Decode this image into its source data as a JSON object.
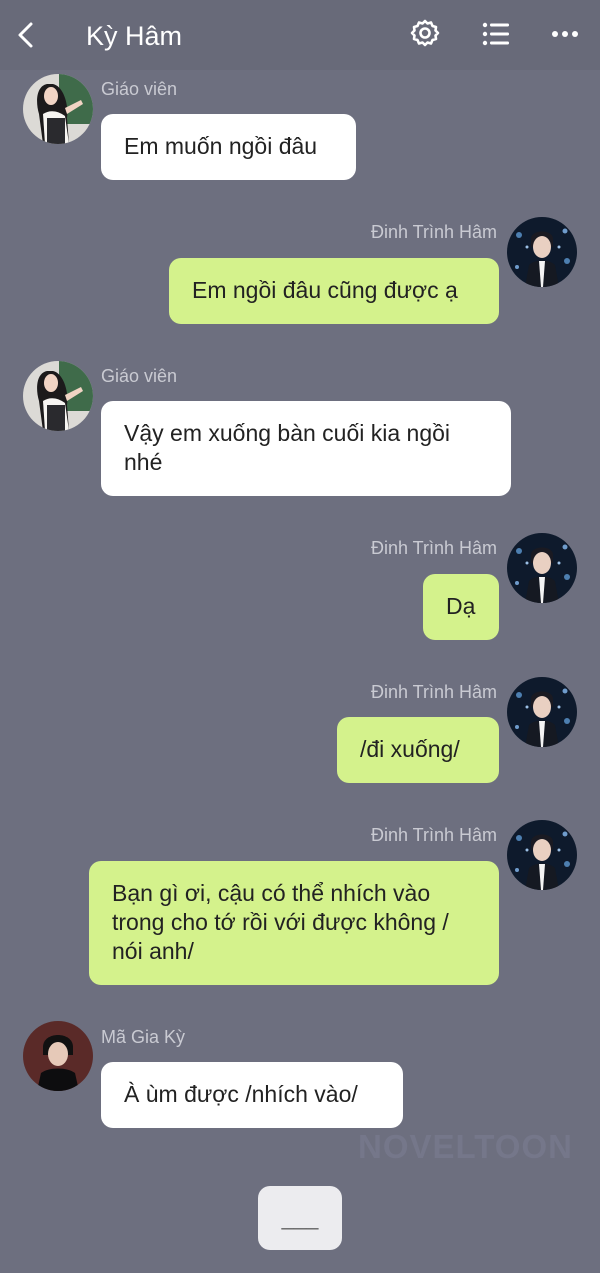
{
  "header": {
    "title": "Kỳ Hâm",
    "icons": [
      "back-icon",
      "gear-icon",
      "list-icon",
      "more-icon"
    ]
  },
  "messages": [
    {
      "sender": "Giáo viên",
      "side": "left",
      "avatar": "teacher",
      "text": "Em muốn ngồi đâu"
    },
    {
      "sender": "Đinh Trình Hâm",
      "side": "right",
      "avatar": "dinh",
      "text": "Em ngồi đâu cũng được ạ"
    },
    {
      "sender": "Giáo viên",
      "side": "left",
      "avatar": "teacher",
      "text": "Vậy em xuống bàn cuối kia ngồi nhé"
    },
    {
      "sender": "Đinh Trình Hâm",
      "side": "right",
      "avatar": "dinh",
      "text": "Dạ"
    },
    {
      "sender": "Đinh Trình Hâm",
      "side": "right",
      "avatar": "dinh",
      "text": "/đi xuống/"
    },
    {
      "sender": "Đinh Trình Hâm",
      "side": "right",
      "avatar": "dinh",
      "text": "Bạn gì ơi, cậu có thể nhích vào trong cho tớ rồi với được không / nói anh/"
    },
    {
      "sender": "Mã Gia Kỳ",
      "side": "left",
      "avatar": "ma",
      "text": "À ùm được /nhích vào/"
    }
  ],
  "watermark": "NOVELTOON",
  "more_button": "___",
  "colors": {
    "background": "#6d6f7f",
    "header": "#686a79",
    "bubble_left": "#ffffff",
    "bubble_right": "#d4f28c",
    "name_text": "#c9cad2"
  }
}
